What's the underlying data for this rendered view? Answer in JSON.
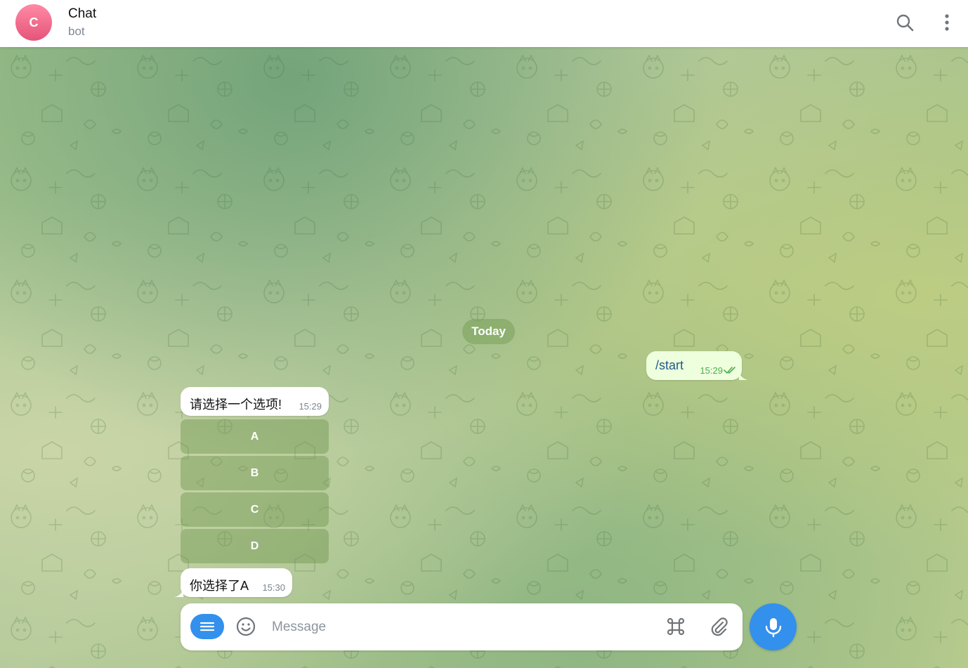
{
  "header": {
    "avatar_letter": "C",
    "title": "Chat",
    "subtitle": "bot",
    "icons": [
      "search-icon",
      "more-vertical-icon"
    ]
  },
  "chat": {
    "date_label": "Today",
    "messages": [
      {
        "direction": "outgoing",
        "text": "/start",
        "time": "15:29",
        "status": "read"
      },
      {
        "direction": "incoming",
        "text": "请选择一个选项!",
        "time": "15:29",
        "inline_buttons": [
          "A",
          "B",
          "C",
          "D"
        ]
      },
      {
        "direction": "incoming",
        "text": "你选择了A",
        "time": "15:30"
      }
    ]
  },
  "composer": {
    "placeholder": "Message",
    "value": "",
    "icons": [
      "menu-icon",
      "emoji-icon",
      "command-icon",
      "attach-icon",
      "microphone-icon"
    ]
  },
  "colors": {
    "accent": "#3390ec",
    "outgoing_bubble": "#eeffde",
    "read_check": "#4fae4e",
    "avatar": "#e5547a"
  }
}
